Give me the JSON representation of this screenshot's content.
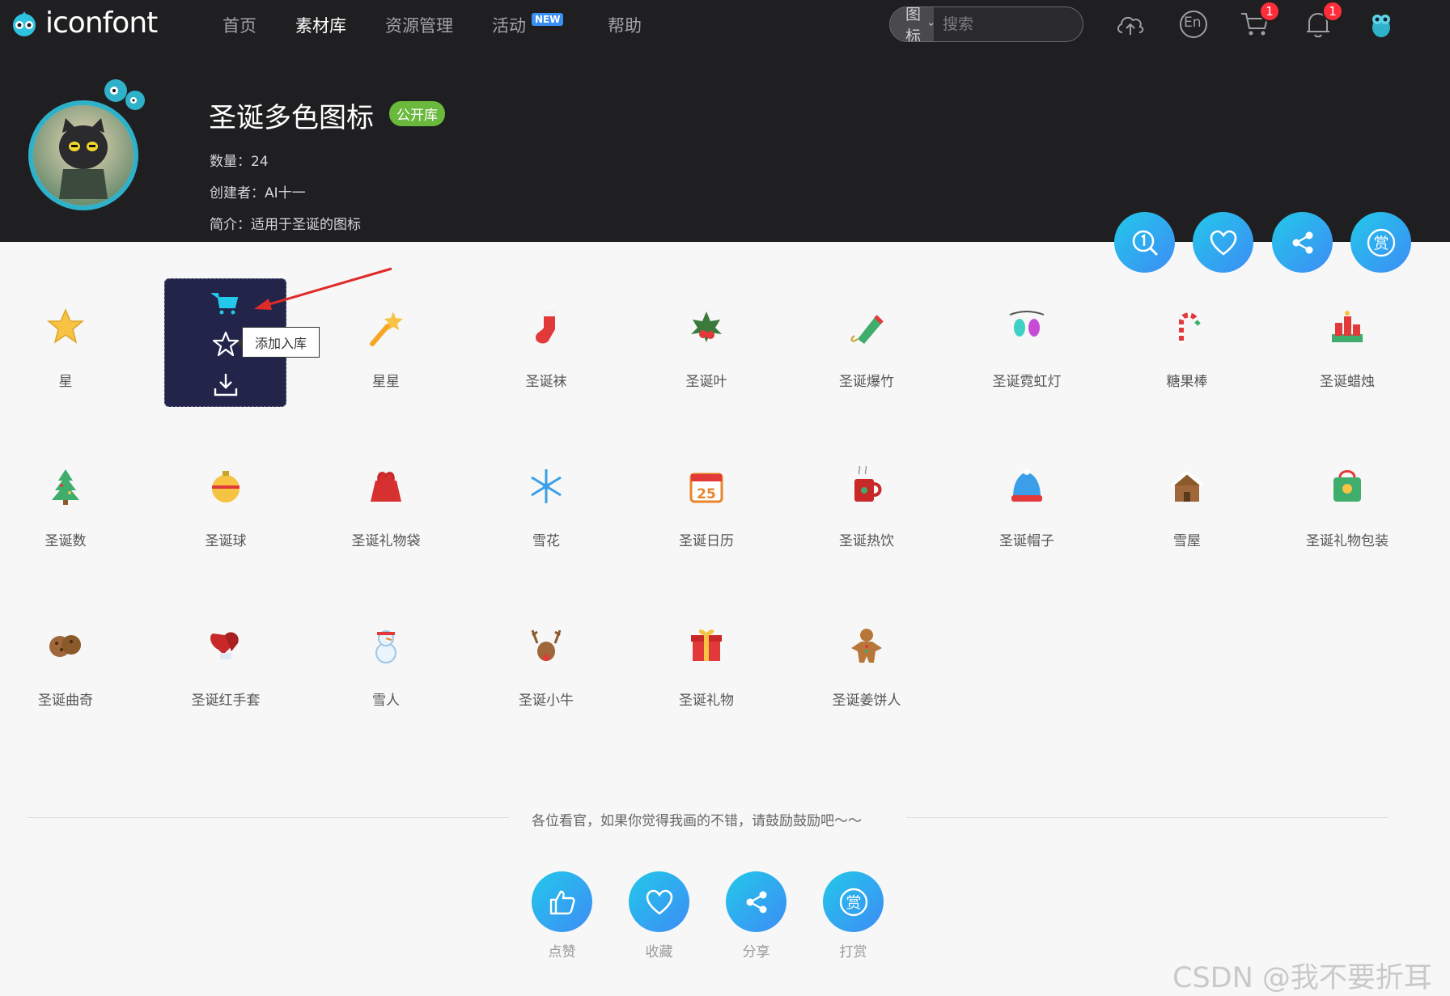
{
  "app": {
    "logo_text": "iconfont"
  },
  "nav": {
    "items": [
      "首页",
      "素材库",
      "资源管理",
      "活动",
      "帮助"
    ],
    "new_badge": "NEW"
  },
  "search": {
    "type_label": "图标",
    "placeholder": "搜索"
  },
  "header_icons": {
    "cart_badge": "1",
    "bell_badge": "1",
    "lang_label": "En"
  },
  "collection": {
    "title": "圣诞多色图标",
    "tag": "公开库",
    "count_label": "数量：",
    "count": "24",
    "creator_label": "创建者：",
    "creator": "AI十一",
    "intro_label": "简介：",
    "intro": "适用于圣诞的图标"
  },
  "hover_actions": {
    "tooltip": "添加入库"
  },
  "icons": [
    "星",
    "",
    "星星",
    "圣诞袜",
    "圣诞叶",
    "圣诞爆竹",
    "圣诞霓虹灯",
    "糖果棒",
    "圣诞蜡烛",
    "圣诞数",
    "圣诞球",
    "圣诞礼物袋",
    "雪花",
    "圣诞日历",
    "圣诞热饮",
    "圣诞帽子",
    "雪屋",
    "圣诞礼物包装",
    "圣诞曲奇",
    "圣诞红手套",
    "雪人",
    "圣诞小牛",
    "圣诞礼物",
    "圣诞姜饼人"
  ],
  "calendar_day": "25",
  "footer": {
    "encourage": "各位看官，如果你觉得我画的不错，请鼓励鼓励吧～～",
    "buttons": [
      "点赞",
      "收藏",
      "分享",
      "打赏"
    ]
  },
  "watermark": "CSDN @我不要折耳根",
  "colors": {
    "accent_gradient_start": "#23c8ea",
    "accent_gradient_end": "#3d8cf5",
    "header_bg": "#1f1f21",
    "tag_green": "#6ab93d",
    "badge_red": "#ff2d3a"
  }
}
